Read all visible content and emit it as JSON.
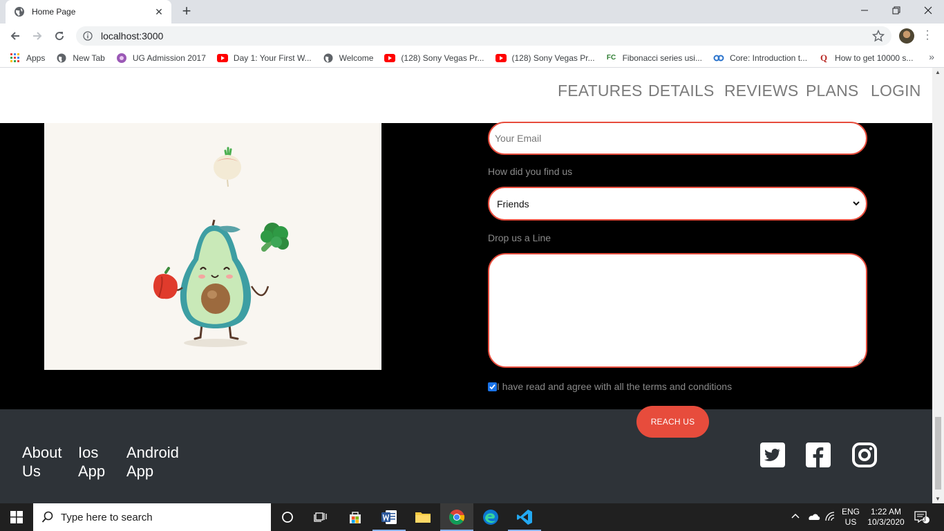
{
  "browser": {
    "tab_title": "Home Page",
    "url": "localhost:3000",
    "bookmarks": [
      {
        "label": "Apps",
        "icon": "apps-grid-icon"
      },
      {
        "label": "New Tab",
        "icon": "globe-icon"
      },
      {
        "label": "UG Admission 2017",
        "icon": "site-icon"
      },
      {
        "label": "Day 1: Your First W...",
        "icon": "youtube-icon"
      },
      {
        "label": "Welcome",
        "icon": "globe-icon"
      },
      {
        "label": "(128) Sony Vegas Pr...",
        "icon": "youtube-icon"
      },
      {
        "label": "(128) Sony Vegas Pr...",
        "icon": "youtube-icon"
      },
      {
        "label": "Fibonacci series usi...",
        "icon": "fc-icon"
      },
      {
        "label": "Core: Introduction t...",
        "icon": "coursera-icon"
      },
      {
        "label": "How to get 10000 s...",
        "icon": "quora-icon"
      }
    ],
    "more": "»"
  },
  "nav": {
    "links": [
      "FEATURES",
      "DETAILS",
      "REVIEWS",
      "PLANS",
      "LOGIN"
    ]
  },
  "form": {
    "email_placeholder": "Your Email",
    "find_label": "How did you find us",
    "find_selected": "Friends",
    "message_label": "Drop us a Line",
    "message_value": "",
    "agree_checked": true,
    "agree_label": "I have read and agree with all the terms and conditions",
    "submit_label": "REACH US"
  },
  "footer": {
    "links": [
      {
        "line1": "About",
        "line2": "Us"
      },
      {
        "line1": "Ios",
        "line2": "App"
      },
      {
        "line1": "Android",
        "line2": "App"
      }
    ],
    "social": [
      "twitter-icon",
      "facebook-icon",
      "instagram-icon"
    ]
  },
  "taskbar": {
    "search_placeholder": "Type here to search",
    "language_top": "ENG",
    "language_bottom": "US",
    "time": "1:22 AM",
    "date": "10/3/2020",
    "notification_count": "3"
  },
  "colors": {
    "accent": "#e74c3c",
    "footer_bg": "#2e3338",
    "nav_text": "#7b7b7b"
  }
}
